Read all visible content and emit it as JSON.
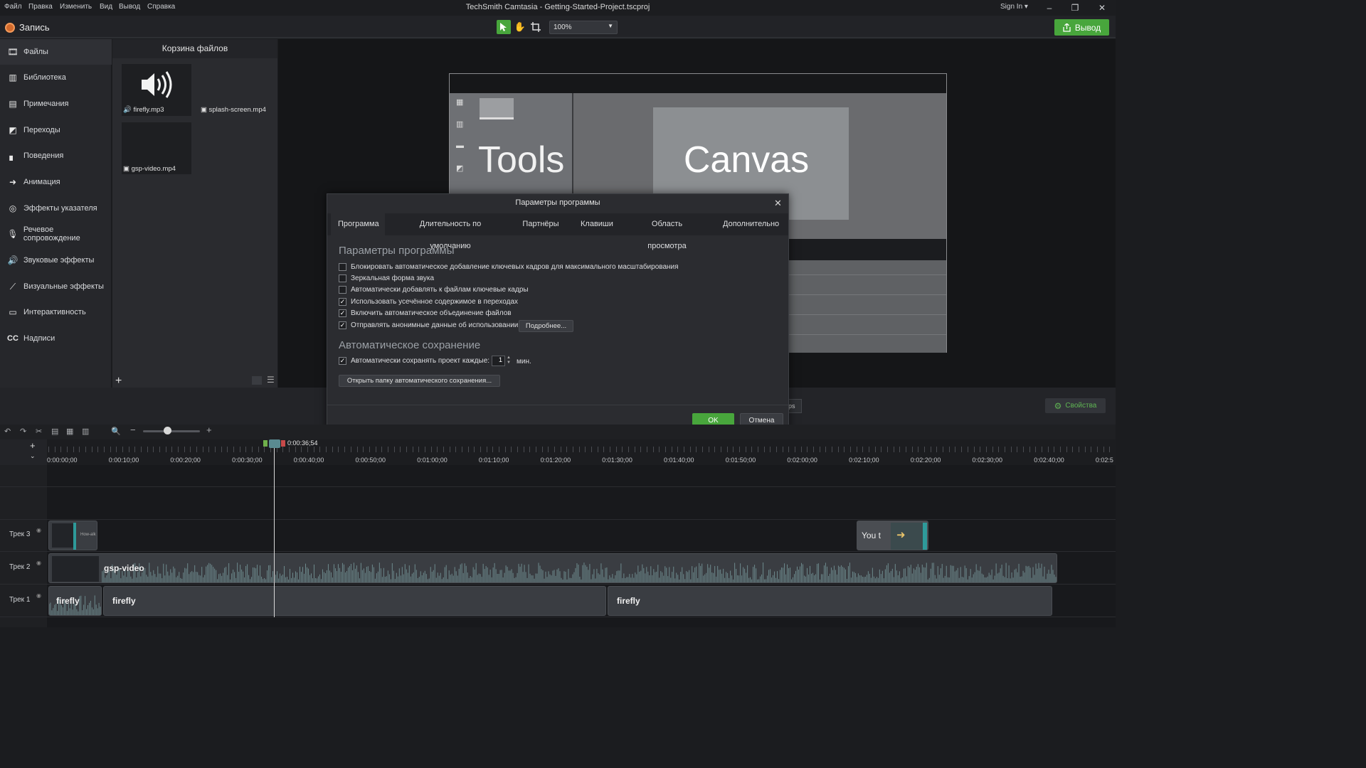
{
  "titlebar": {
    "menu": [
      "Файл",
      "Правка",
      "Изменить",
      "Вид",
      "Вывод",
      "Справка"
    ],
    "title": "TechSmith Camtasia - Getting-Started-Project.tscproj",
    "signin": "Sign In",
    "win_min": "–",
    "win_restore": "❐",
    "win_close": "✕"
  },
  "toolbar": {
    "record": "Запись",
    "zoom": "100%",
    "export": "Вывод"
  },
  "sidebar": {
    "items": [
      {
        "label": "Файлы",
        "icon": "film-strip-icon"
      },
      {
        "label": "Библиотека",
        "icon": "library-icon"
      },
      {
        "label": "Примечания",
        "icon": "annotation-icon"
      },
      {
        "label": "Переходы",
        "icon": "transition-icon"
      },
      {
        "label": "Поведения",
        "icon": "behaviors-icon"
      },
      {
        "label": "Анимация",
        "icon": "animation-icon"
      },
      {
        "label": "Эффекты указателя",
        "icon": "cursor-effects-icon"
      },
      {
        "label": "Речевое сопровождение",
        "icon": "microphone-icon"
      },
      {
        "label": "Звуковые эффекты",
        "icon": "speaker-icon"
      },
      {
        "label": "Визуальные эффекты",
        "icon": "magic-wand-icon"
      },
      {
        "label": "Интерактивность",
        "icon": "interactivity-icon"
      },
      {
        "label": "Надписи",
        "icon": "captions-icon"
      }
    ]
  },
  "bin": {
    "title": "Корзина файлов",
    "files": [
      "firefly.mp3",
      "splash-screen.mp4",
      "gsp-video.mp4"
    ]
  },
  "canvas": {
    "tools_text": "Tools",
    "canvas_text": "Canvas"
  },
  "dialog": {
    "title": "Параметры программы",
    "tabs": [
      "Программа",
      "Длительность по умолчанию",
      "Партнёры",
      "Клавиши",
      "Область просмотра",
      "Дополнительно"
    ],
    "section1": "Параметры программы",
    "options": [
      {
        "label": "Блокировать автоматическое добавление ключевых кадров для максимального масштабирования",
        "checked": false
      },
      {
        "label": "Зеркальная форма звука",
        "checked": false
      },
      {
        "label": "Автоматически добавлять к файлам ключевые кадры",
        "checked": false
      },
      {
        "label": "Использовать усечённое содержимое в переходах",
        "checked": true
      },
      {
        "label": "Включить автоматическое объединение файлов",
        "checked": true
      },
      {
        "label": "Отправлять анонимные данные об использовании",
        "checked": true
      }
    ],
    "more_button": "Подробнее...",
    "section2": "Автоматическое сохранение",
    "autosave_label": "Автоматически сохранять проект каждые:",
    "autosave_value": "1",
    "autosave_unit": "мин.",
    "open_folder_button": "Открыть папку автоматического сохранения...",
    "ok": "OK",
    "cancel": "Отмена"
  },
  "properties_button": "Свойства",
  "fps_chip": "ps",
  "timeline": {
    "playhead_time": "0:00:36;54",
    "ticks": [
      "0:00:00;00",
      "0:00:10;00",
      "0:00:20;00",
      "0:00:30;00",
      "0:00:40;00",
      "0:00:50;00",
      "0:01:00;00",
      "0:01:10;00",
      "0:01:20;00",
      "0:01:30;00",
      "0:01:40;00",
      "0:01:50;00",
      "0:02:00;00",
      "0:02:10;00",
      "0:02:20;00",
      "0:02:30;00",
      "0:02:40;00",
      "0:02:5"
    ],
    "tracks": [
      "Трек 3",
      "Трек 2",
      "Трек 1"
    ],
    "clips": {
      "track3_small": "How-alk",
      "track3_right": "You t",
      "track2": "gsp-video",
      "track1_a": "firefly",
      "track1_b": "firefly",
      "track1_c": "firefly"
    }
  }
}
